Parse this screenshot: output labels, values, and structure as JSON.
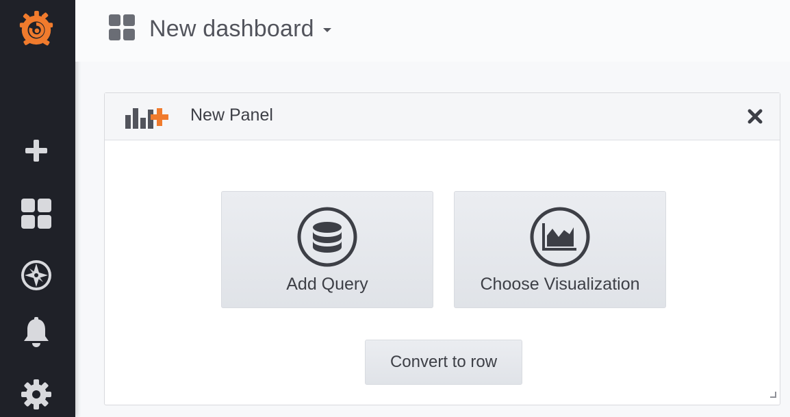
{
  "header": {
    "title": "New dashboard"
  },
  "sidebar": {
    "items": [
      {
        "icon": "grafana-logo-icon"
      },
      {
        "icon": "plus-icon"
      },
      {
        "icon": "dashboards-grid-icon"
      },
      {
        "icon": "explore-compass-icon"
      },
      {
        "icon": "alerting-bell-icon"
      },
      {
        "icon": "configuration-gear-icon"
      }
    ]
  },
  "panel": {
    "title": "New Panel",
    "add_query_label": "Add Query",
    "choose_visualization_label": "Choose Visualization",
    "convert_to_row_label": "Convert to row"
  },
  "colors": {
    "sidebar_bg": "#1f2128",
    "accent_orange": "#f07b2d",
    "sidebar_icon": "#d8d9dd",
    "text_dark": "#3d3f46"
  }
}
